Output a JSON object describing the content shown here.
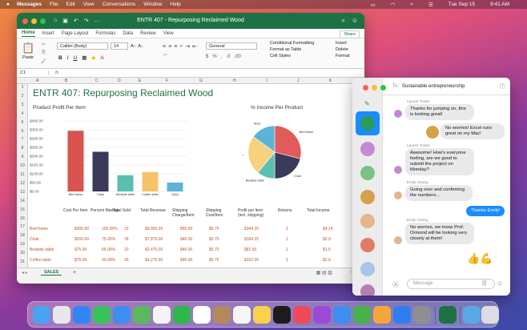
{
  "menubar": {
    "app": "Messages",
    "items": [
      "File",
      "Edit",
      "View",
      "Conversations",
      "Window",
      "Help"
    ],
    "date": "Tue Sep 15",
    "time": "9:41 AM"
  },
  "excel": {
    "title": "ENTR 407 - Repurposing Reclaimed Wood",
    "tabs": [
      "Home",
      "Insert",
      "Page Layout",
      "Formulas",
      "Data",
      "Review",
      "View"
    ],
    "share": "Share",
    "ribbon": {
      "paste": "Paste",
      "font": "Calibri (Body)",
      "size": "14",
      "number_format": "General",
      "conditional": "Conditional Formatting",
      "format_table": "Format as Table",
      "cell_styles": "Cell Styles",
      "insert": "Insert",
      "delete": "Delete",
      "format": "Format",
      "editing": "Editing"
    },
    "name_box": "C1",
    "fx": "fx",
    "columns": [
      "A",
      "B",
      "C",
      "D",
      "E",
      "F",
      "G",
      "H",
      "I",
      "J",
      "K"
    ],
    "sheet_title": "ENTR 407: Repurposing Reclaimed Wood",
    "bar_title": "Product Profit Per Item",
    "pie_title": "% Income Per Product",
    "table_headers": [
      "Cost Per Item",
      "Percent Markup",
      "Total Sold",
      "Total Revenue",
      "Shipping Charge/Item",
      "Shipping Cost/Item",
      "Profit per item (incl. shipping)",
      "Returns",
      "Total Income"
    ],
    "rows": [
      {
        "name": "Bed frame",
        "cost": "$300.00",
        "markup": "100.00%",
        "sold": "15",
        "revenue": "$9,000.00",
        "charge": "$50.00",
        "scost": "$5.75",
        "profit": "$344.25",
        "returns": "2",
        "income": "$4,14"
      },
      {
        "name": "Chair",
        "cost": "$200.00",
        "markup": "75.00%",
        "sold": "18",
        "revenue": "$7,875.00",
        "charge": "$40.00",
        "scost": "$5.75",
        "profit": "$184.25",
        "returns": "2",
        "income": "$2,9"
      },
      {
        "name": "Bedside table",
        "cost": "$75.00",
        "markup": "65.00%",
        "sold": "20",
        "revenue": "$2,475.00",
        "charge": "$40.00",
        "scost": "$5.75",
        "profit": "$82.50",
        "returns": "1",
        "income": "$1,5"
      },
      {
        "name": "Coffee table",
        "cost": "$75.00",
        "markup": "90.00%",
        "sold": "30",
        "revenue": "$4,275.00",
        "charge": "$40.00",
        "scost": "$5.75",
        "profit": "$102.00",
        "returns": "1",
        "income": "$2,9"
      },
      {
        "name": "Stool",
        "cost": "$45.00",
        "markup": "90.00%",
        "sold": "50",
        "revenue": "$3,501.00",
        "charge": "$0.00",
        "scost": "$5.75",
        "profit": "$35.25",
        "returns": "0",
        "income": "$1,7"
      }
    ],
    "row_numbers": [
      "1",
      "2",
      "3",
      "4",
      "5",
      "6",
      "7",
      "8",
      "9",
      "10",
      "11",
      "12",
      "13",
      "14",
      "15",
      "16",
      "17",
      "18",
      "19",
      "20",
      "21"
    ],
    "sheet_tab": "SALES",
    "add_sheet": "+"
  },
  "chart_data": [
    {
      "type": "bar",
      "title": "Product Profit Per Item",
      "categories": [
        "Bed frame",
        "Chair",
        "Bedside table",
        "Coffee table",
        "Stool"
      ],
      "values": [
        344.25,
        225,
        92,
        110,
        50
      ],
      "ylim": [
        0,
        400
      ],
      "yticks": [
        "$400.00",
        "$350.00",
        "$300.00",
        "$250.00",
        "$200.00",
        "$150.00",
        "$100.00",
        "$50.00",
        "$0.00"
      ],
      "colors": [
        "#d9534f",
        "#3a3a5a",
        "#5bbfb0",
        "#f6c36a",
        "#5cb3d8"
      ]
    },
    {
      "type": "pie",
      "title": "% Income Per Product",
      "categories": [
        "Bed frame",
        "Chair",
        "Bedside table",
        "Coffee table",
        "Stool"
      ],
      "values": [
        29,
        21,
        11,
        24,
        15
      ],
      "colors": [
        "#e25a5a",
        "#3a3a5a",
        "#5bbfb0",
        "#f6d27a",
        "#5cb3d8"
      ]
    }
  ],
  "messages": {
    "to_label": "To:",
    "to": "Sustainable entrepreneurship",
    "thread": [
      {
        "sender": "Lauren Trotter",
        "text": "Thanks for jumping on, this is looking great!",
        "me": false
      },
      {
        "text": "No worries! Excel runs great on my Mac!",
        "me": true,
        "style": "light"
      },
      {
        "sender": "Lauren Trotter",
        "text": "Awesome! How's everyone feeling, are we good to submit the project on Monday?",
        "me": false
      },
      {
        "sender": "Emily Chang",
        "text": "Going over and confirming the numbers...",
        "me": false
      },
      {
        "text": "Thanks Emily!",
        "me": true
      },
      {
        "sender": "Emily Chang",
        "text": "No worries, we know Prof. Ormond will be looking very closely at them!",
        "me": false
      }
    ],
    "placeholder": "Message",
    "reaction": "👍💪"
  }
}
